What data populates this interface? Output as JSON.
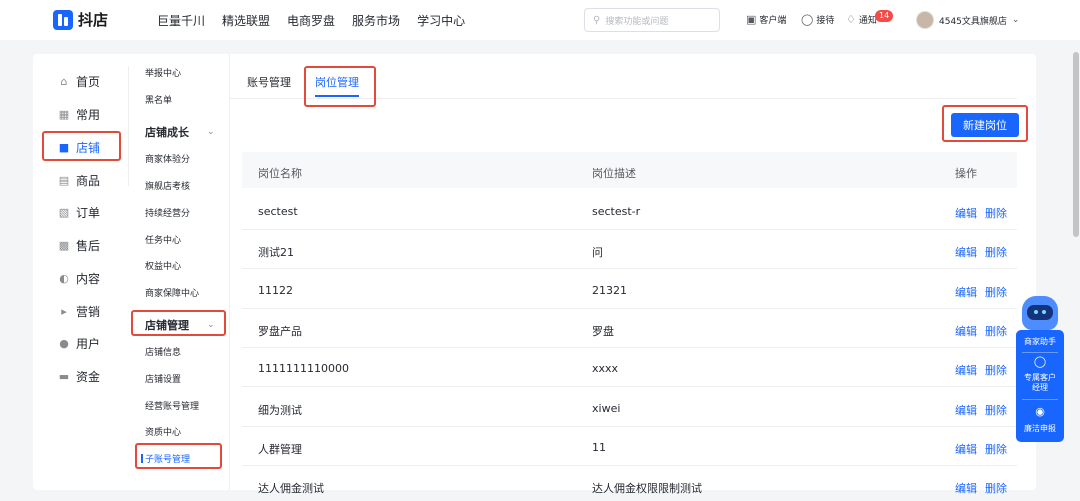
{
  "header": {
    "logo_text": "抖店",
    "nav": [
      "巨量千川",
      "精选联盟",
      "电商罗盘",
      "服务市场",
      "学习中心"
    ],
    "search_placeholder": "搜索功能或问题",
    "tools": {
      "client": "客户端",
      "reception": "接待",
      "notice": "通知",
      "notice_count": "14"
    },
    "store_name": "4545文具旗舰店"
  },
  "nav1": [
    {
      "label": "首页",
      "icon": "home-icon"
    },
    {
      "label": "常用",
      "icon": "grid-icon"
    },
    {
      "label": "店铺",
      "icon": "store-icon",
      "active": true
    },
    {
      "label": "商品",
      "icon": "goods-icon"
    },
    {
      "label": "订单",
      "icon": "order-icon"
    },
    {
      "label": "售后",
      "icon": "after-sale-icon"
    },
    {
      "label": "内容",
      "icon": "content-icon"
    },
    {
      "label": "营销",
      "icon": "megaphone-icon"
    },
    {
      "label": "用户",
      "icon": "user-icon"
    },
    {
      "label": "资金",
      "icon": "wallet-icon"
    }
  ],
  "nav2": {
    "top_items": [
      "举报中心",
      "黑名单"
    ],
    "group1": "店铺成长",
    "group1_items": [
      "商家体验分",
      "旗舰店考核",
      "持续经营分",
      "任务中心",
      "权益中心",
      "商家保障中心"
    ],
    "group2": "店铺管理",
    "group2_items": [
      "店铺信息",
      "店铺设置",
      "经营账号管理",
      "资质中心",
      "子账号管理"
    ]
  },
  "tabs": [
    "账号管理",
    "岗位管理"
  ],
  "new_button": "新建岗位",
  "table": {
    "headers": [
      "岗位名称",
      "岗位描述",
      "操作"
    ],
    "edit": "编辑",
    "delete": "删除",
    "rows": [
      {
        "name": "sectest",
        "desc": "sectest-r"
      },
      {
        "name": "测试21",
        "desc": "问"
      },
      {
        "name": "11122",
        "desc": "21321"
      },
      {
        "name": "罗盘产品",
        "desc": "罗盘"
      },
      {
        "name": "1111111110000",
        "desc": "xxxx"
      },
      {
        "name": "细为测试",
        "desc": "xiwei"
      },
      {
        "name": "人群管理",
        "desc": "11"
      },
      {
        "name": "达人佣金测试",
        "desc": "达人佣金权限限制测试"
      }
    ]
  },
  "assistant": {
    "helper": "商家助手",
    "manager_line1": "专属客户",
    "manager_line2": "经理",
    "report": "廉洁申报"
  }
}
